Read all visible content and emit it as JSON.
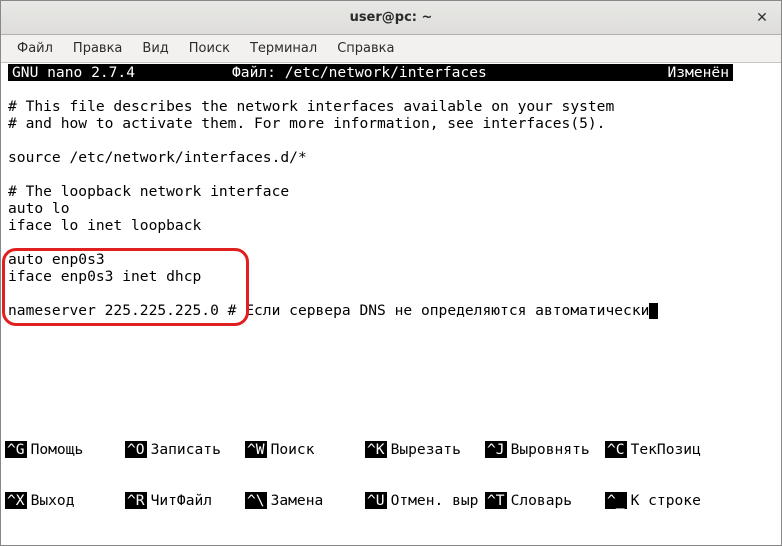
{
  "window": {
    "title": "user@pc: ~"
  },
  "menu": {
    "file": "Файл",
    "edit": "Правка",
    "view": "Вид",
    "search": "Поиск",
    "terminal": "Терминал",
    "help": "Справка"
  },
  "nano": {
    "version": "  GNU nano 2.7.4",
    "file_label": "Файл: /etc/network/interfaces",
    "status": "Изменён"
  },
  "file_content": {
    "l1": "# This file describes the network interfaces available on your system",
    "l2": "# and how to activate them. For more information, see interfaces(5).",
    "l3": "",
    "l4": "source /etc/network/interfaces.d/*",
    "l5": "",
    "l6": "# The loopback network interface",
    "l7": "auto lo",
    "l8": "iface lo inet loopback",
    "l9": "",
    "l10": "auto enp0s3",
    "l11": "iface enp0s3 inet dhcp",
    "l12": "",
    "l13a": "nameserver 225.225.225.0",
    "l13b": " # Если сервера DNS не определяются автоматически"
  },
  "footer": {
    "k1": "^G",
    "v1": "Помощь",
    "k2": "^O",
    "v2": "Записать",
    "k3": "^W",
    "v3": "Поиск",
    "k4": "^K",
    "v4": "Вырезать",
    "k5": "^J",
    "v5": "Выровнять",
    "k6": "^C",
    "v6": "ТекПозиц",
    "k7": "^X",
    "v7": "Выход",
    "k8": "^R",
    "v8": "ЧитФайл",
    "k9": "^\\",
    "v9": "Замена",
    "k10": "^U",
    "v10": "Отмен. выр",
    "k11": "^T",
    "v11": "Словарь",
    "k12": "^_",
    "v12": "К строке"
  }
}
